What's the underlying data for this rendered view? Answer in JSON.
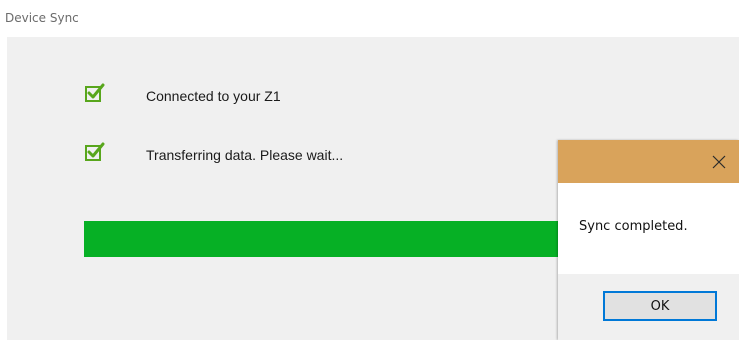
{
  "window": {
    "title": "Device Sync"
  },
  "steps": [
    {
      "label": "Connected to your Z1",
      "icon": "checkbox-checked-icon",
      "done": true
    },
    {
      "label": "Transferring data. Please wait...",
      "icon": "checkbox-checked-icon",
      "done": true
    }
  ],
  "progress": {
    "value_fraction": 1.0,
    "color": "#06b025"
  },
  "dialog": {
    "close_icon": "close-icon",
    "message": "Sync completed.",
    "ok_label": "OK",
    "titlebar_color": "#d9a35b",
    "accent": "#0078d7"
  }
}
